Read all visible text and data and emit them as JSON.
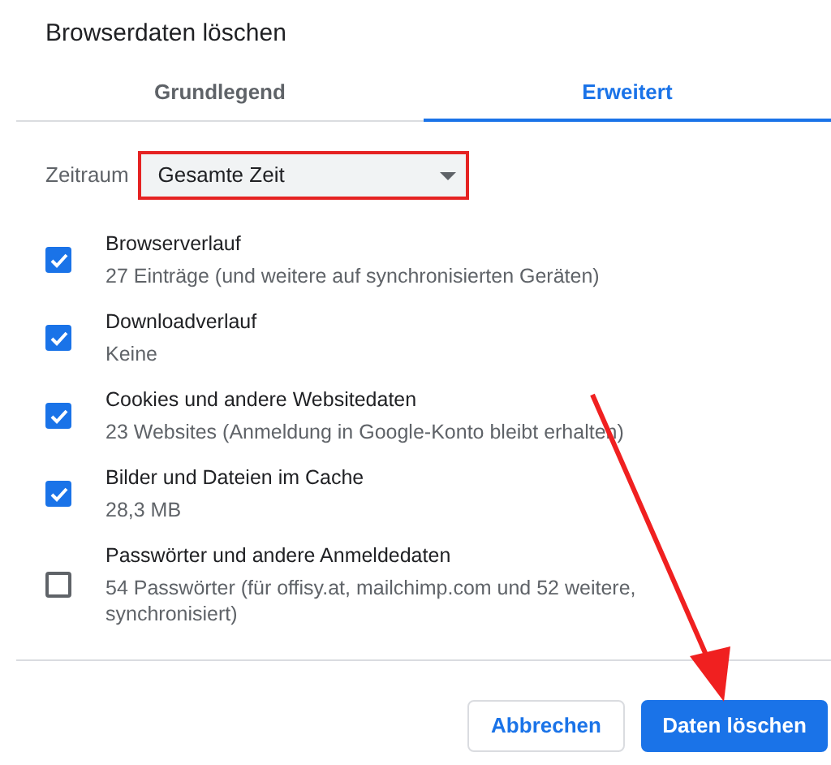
{
  "dialog": {
    "title": "Browserdaten löschen"
  },
  "tabs": [
    {
      "label": "Grundlegend",
      "selected": false
    },
    {
      "label": "Erweitert",
      "selected": true
    }
  ],
  "time_range": {
    "label": "Zeitraum",
    "value": "Gesamte Zeit",
    "highlighted": true
  },
  "items": [
    {
      "title": "Browserverlauf",
      "detail": "27 Einträge (und weitere auf synchronisierten Geräten)",
      "checked": true
    },
    {
      "title": "Downloadverlauf",
      "detail": "Keine",
      "checked": true
    },
    {
      "title": "Cookies und andere Websitedaten",
      "detail": "23 Websites (Anmeldung in Google-Konto bleibt erhalten)",
      "checked": true
    },
    {
      "title": "Bilder und Dateien im Cache",
      "detail": "28,3 MB",
      "checked": true
    },
    {
      "title": "Passwörter und andere Anmeldedaten",
      "detail": "54 Passwörter (für offisy.at, mailchimp.com und 52 weitere, synchronisiert)",
      "checked": false
    }
  ],
  "buttons": [
    {
      "label": "Abbrechen",
      "kind": "secondary"
    },
    {
      "label": "Daten löschen",
      "kind": "primary"
    }
  ]
}
